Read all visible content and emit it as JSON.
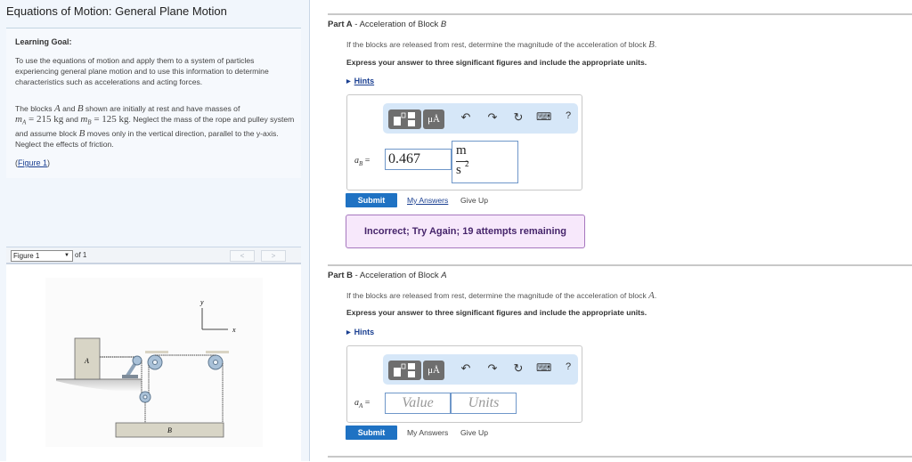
{
  "left": {
    "title": "Equations of Motion: General Plane Motion",
    "learning_goal_heading": "Learning Goal:",
    "learning_goal_text": "To use the equations of motion and apply them to a system of particles experiencing general plane motion and to use this information to determine characteristics such as accelerations and acting forces.",
    "problem": {
      "t1": "The blocks ",
      "blockA": "A",
      "t2": " and ",
      "blockB": "B",
      "t3": " shown are initially at rest and have masses of",
      "mA_sym": "m",
      "mA_sub": "A",
      "mA_val": " = 215 kg",
      "t4": " and ",
      "mB_sym": "m",
      "mB_sub": "B",
      "mB_val": " = 125 kg",
      "t5": ". Neglect the mass of the rope and pulley system and assume block ",
      "blockB2": "B",
      "t6": " moves only in the vertical direction, parallel to the y-axis. Neglect the effects of friction."
    },
    "figure_link_open": "(",
    "figure_link": "Figure 1",
    "figure_link_close": ")",
    "figure_panel": {
      "selected": "Figure 1",
      "of_label": "of 1",
      "prev": "<",
      "next": ">",
      "labels": {
        "block_a": "A",
        "block_b": "B",
        "axis_x": "x",
        "axis_y": "y"
      }
    }
  },
  "partA": {
    "part": "Part A",
    "sep": " - ",
    "title": "Acceleration of Block ",
    "title_var": "B",
    "question": "If the blocks are released from rest, determine the magnitude of the acceleration of block ",
    "question_var": "B",
    "question_end": ".",
    "instruction": "Express your answer to three significant figures and include the appropriate units.",
    "hints": "Hints",
    "answer_label_sym": "a",
    "answer_label_sub": "B",
    "answer_label_eq": " =",
    "value": "0.467",
    "units_num": "m",
    "units_den": "s",
    "units_exp": "2",
    "submit": "Submit",
    "my_answers": "My Answers",
    "give_up": "Give Up",
    "feedback": "Incorrect; Try Again; 19 attempts remaining"
  },
  "partB": {
    "part": "Part B",
    "sep": " - ",
    "title": "Acceleration of Block ",
    "title_var": "A",
    "question": "If the blocks are released from rest, determine the magnitude of the acceleration of block ",
    "question_var": "A",
    "question_end": ".",
    "instruction": "Express your answer to three significant figures and include the appropriate units.",
    "hints": "Hints",
    "answer_label_sym": "a",
    "answer_label_sub": "A",
    "answer_label_eq": " =",
    "value_placeholder": "Value",
    "units_placeholder": "Units",
    "submit": "Submit",
    "my_answers": "My Answers",
    "give_up": "Give Up"
  },
  "toolbar": {
    "mu_label": "μÅ",
    "undo": "↶",
    "redo": "↷",
    "reset": "↻",
    "keyboard": "⌨",
    "help": "?"
  },
  "colors": {
    "submit": "#1f72c3",
    "feedback_bg": "#f7e8fb",
    "feedback_border": "#a677be",
    "link": "#1a3f91",
    "toolbar_bg": "#d6e7f8"
  }
}
